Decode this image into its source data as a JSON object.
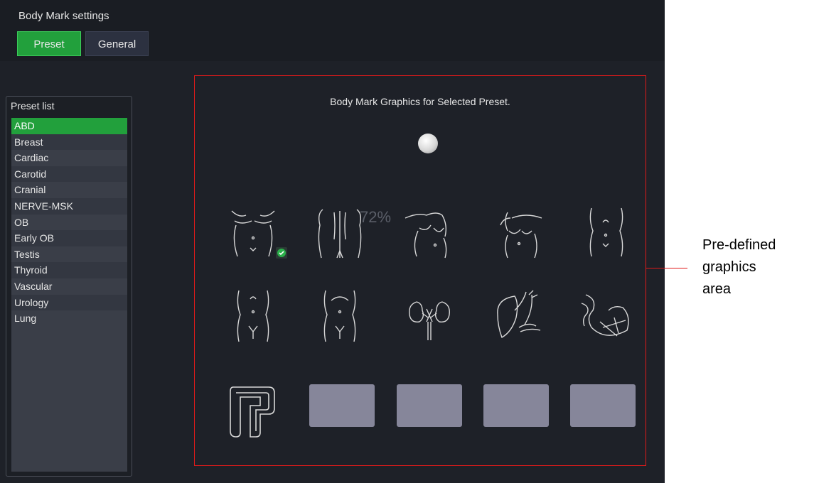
{
  "window": {
    "title": "Body Mark settings"
  },
  "tabs": [
    {
      "label": "Preset",
      "active": true
    },
    {
      "label": "General",
      "active": false
    }
  ],
  "preset_list": {
    "header": "Preset list",
    "items": [
      "ABD",
      "Breast",
      "Cardiac",
      "Carotid",
      "Cranial",
      "NERVE-MSK",
      "OB",
      "Early OB",
      "Testis",
      "Thyroid",
      "Vascular",
      "Urology",
      "Lung"
    ],
    "selected": "ABD"
  },
  "graphics": {
    "heading": "Body Mark Graphics for Selected Preset.",
    "zoom_overlay": "72%",
    "icons": [
      "torso-front-icon",
      "back-icon",
      "breast-left-icon",
      "breast-right-icon",
      "abdomen-icon",
      "abdomen-lower-icon",
      "abdomen-pelvis-icon",
      "kidneys-icon",
      "liver-icon",
      "stomach-icon",
      "probe-icon"
    ],
    "empty_slots": 4,
    "selected_icon": "torso-front-icon"
  },
  "annotation": {
    "lines": [
      "Pre-defined",
      "graphics",
      "area"
    ]
  },
  "colors": {
    "accent": "#22a03c",
    "frame": "#e01a1a",
    "background": "#1e2128"
  }
}
